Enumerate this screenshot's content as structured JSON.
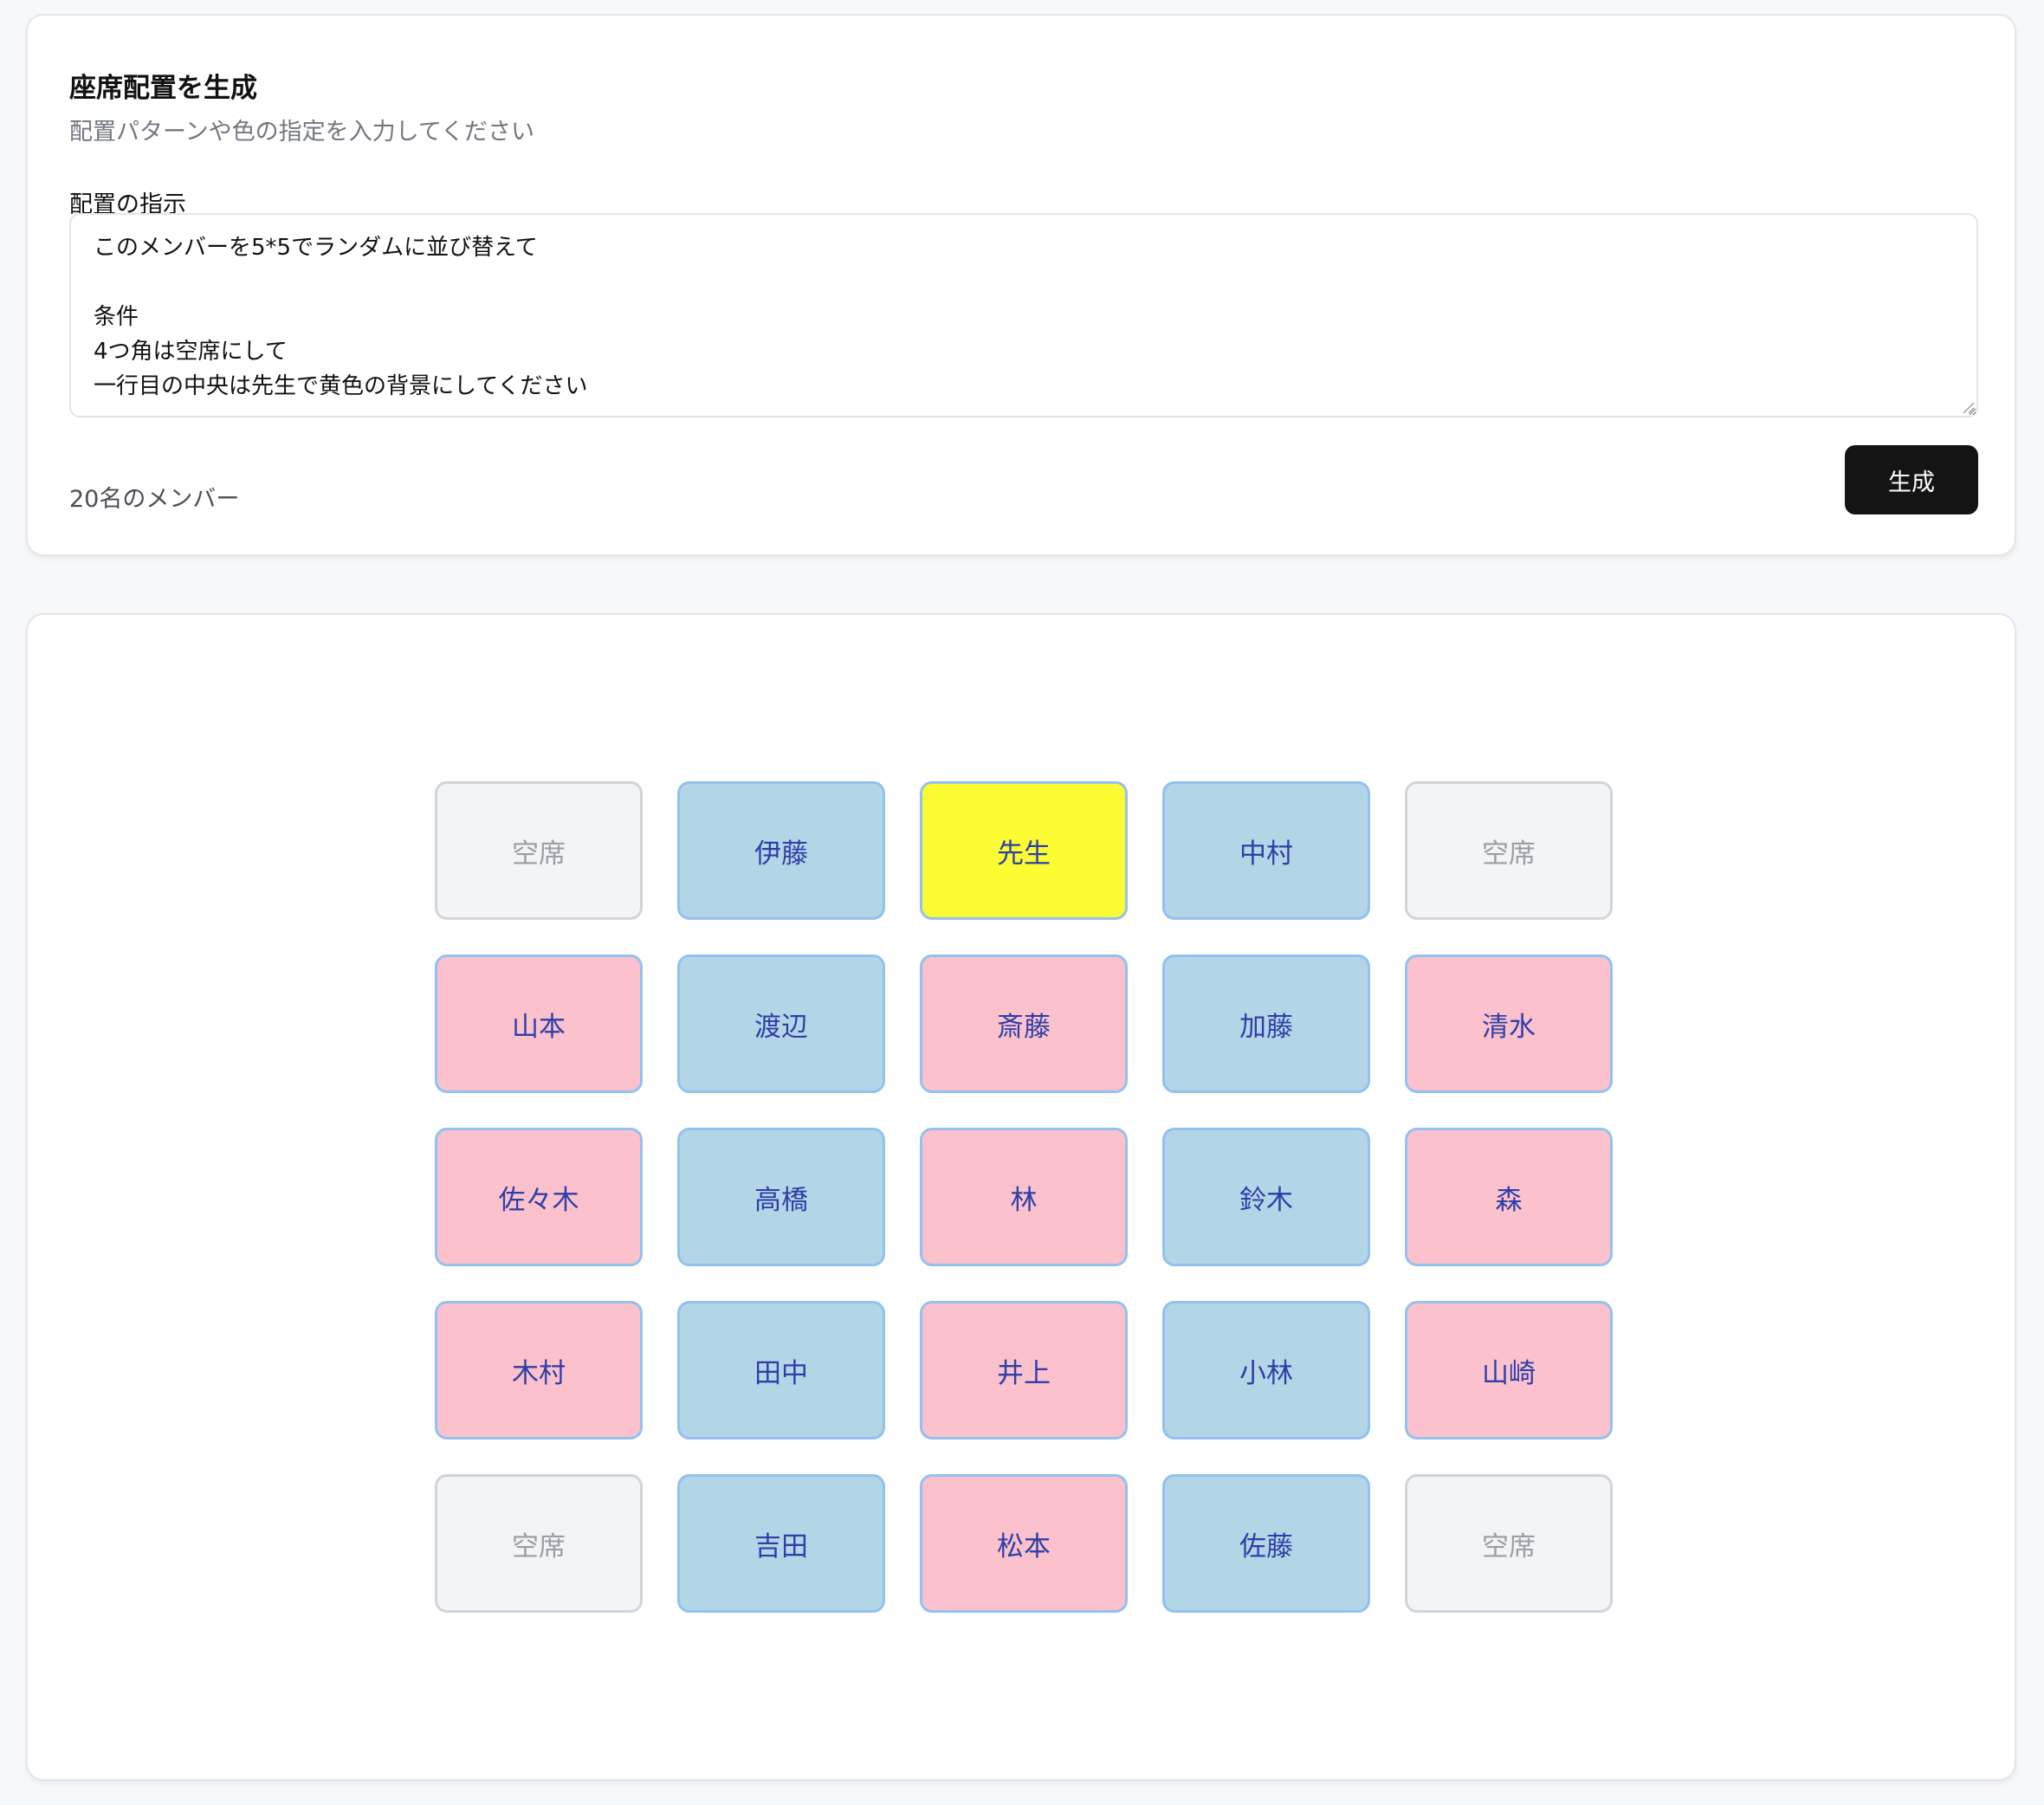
{
  "form": {
    "title": "座席配置を生成",
    "subtitle": "配置パターンや色の指定を入力してください",
    "field_label": "配置の指示",
    "instruction_text": "このメンバーを5*5でランダムに並び替えて\n\n条件\n4つ角は空席にして\n一行目の中央は先生で黄色の背景にしてください",
    "member_count": "20名のメンバー",
    "generate_label": "生成"
  },
  "seating": {
    "rows": [
      [
        {
          "name": "空席",
          "bg": "#f3f4f6",
          "type": "empty"
        },
        {
          "name": "伊藤",
          "bg": "#b3d6e6",
          "type": "member"
        },
        {
          "name": "先生",
          "bg": "#fcfc32",
          "type": "teacher"
        },
        {
          "name": "中村",
          "bg": "#b3d6e6",
          "type": "member"
        },
        {
          "name": "空席",
          "bg": "#f3f4f6",
          "type": "empty"
        }
      ],
      [
        {
          "name": "山本",
          "bg": "#fbc1cc",
          "type": "member"
        },
        {
          "name": "渡辺",
          "bg": "#b3d6e6",
          "type": "member"
        },
        {
          "name": "斎藤",
          "bg": "#fbc1cc",
          "type": "member"
        },
        {
          "name": "加藤",
          "bg": "#b3d6e6",
          "type": "member"
        },
        {
          "name": "清水",
          "bg": "#fbc1cc",
          "type": "member"
        }
      ],
      [
        {
          "name": "佐々木",
          "bg": "#fbc1cc",
          "type": "member"
        },
        {
          "name": "高橋",
          "bg": "#b3d6e6",
          "type": "member"
        },
        {
          "name": "林",
          "bg": "#fbc1cc",
          "type": "member"
        },
        {
          "name": "鈴木",
          "bg": "#b3d6e6",
          "type": "member"
        },
        {
          "name": "森",
          "bg": "#fbc1cc",
          "type": "member"
        }
      ],
      [
        {
          "name": "木村",
          "bg": "#fbc1cc",
          "type": "member"
        },
        {
          "name": "田中",
          "bg": "#b3d6e6",
          "type": "member"
        },
        {
          "name": "井上",
          "bg": "#fbc1cc",
          "type": "member"
        },
        {
          "name": "小林",
          "bg": "#b3d6e6",
          "type": "member"
        },
        {
          "name": "山崎",
          "bg": "#fbc1cc",
          "type": "member"
        }
      ],
      [
        {
          "name": "空席",
          "bg": "#f3f4f6",
          "type": "empty"
        },
        {
          "name": "吉田",
          "bg": "#b3d6e6",
          "type": "member"
        },
        {
          "name": "松本",
          "bg": "#fbc1cc",
          "type": "member"
        },
        {
          "name": "佐藤",
          "bg": "#b3d6e6",
          "type": "member"
        },
        {
          "name": "空席",
          "bg": "#f3f4f6",
          "type": "empty"
        }
      ]
    ]
  }
}
